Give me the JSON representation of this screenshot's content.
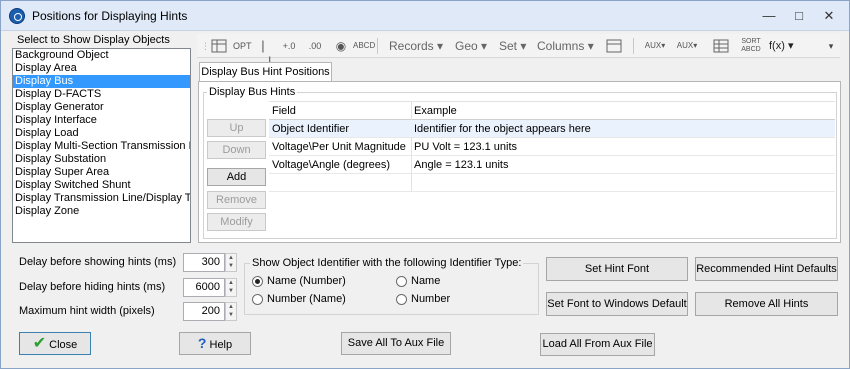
{
  "window": {
    "title": "Positions for Displaying Hints"
  },
  "left_panel": {
    "label": "Select to Show Display Objects",
    "items": [
      "Background Object",
      "Display Area",
      "Display Bus",
      "Display D-FACTS",
      "Display Generator",
      "Display Interface",
      "Display Load",
      "Display Multi-Section Transmission Line",
      "Display Substation",
      "Display Super Area",
      "Display Switched Shunt",
      "Display Transmission Line/Display Transformer",
      "Display Zone"
    ],
    "selected_index": 2
  },
  "toolbar": {
    "records": "Records",
    "geo": "Geo",
    "set": "Set",
    "columns": "Columns",
    "fx": "f(x)",
    "icons": [
      "table-format-icon",
      "optimal-column-width-icon",
      "freeze-panes-icon",
      "decimals-increase-icon",
      "decimals-decrease-icon",
      "find-icon",
      "find-abcd-icon",
      "records-menu",
      "geo-menu",
      "set-menu",
      "columns-menu",
      "auxiliary-export-icon",
      "auxiliary-icon",
      "filter-grid-icon",
      "sort-abcd-icon",
      "function-icon",
      "toolbar-overflow-icon"
    ]
  },
  "tab": {
    "label": "Display Bus Hint Positions"
  },
  "hints_group": {
    "label": "Display Bus Hints",
    "buttons": {
      "up": "Up",
      "down": "Down",
      "add": "Add",
      "remove": "Remove",
      "modify": "Modify"
    },
    "columns": [
      "Field",
      "Example"
    ],
    "rows": [
      {
        "field": "Object Identifier",
        "example": "Identifier for the object appears here"
      },
      {
        "field": "Voltage\\Per Unit Magnitude",
        "example": "PU Volt = 123.1 units"
      },
      {
        "field": "Voltage\\Angle (degrees)",
        "example": "Angle = 123.1 units"
      }
    ]
  },
  "settings": {
    "delay_show_label": "Delay before showing hints (ms)",
    "delay_show_value": "300",
    "delay_hide_label": "Delay before hiding hints (ms)",
    "delay_hide_value": "6000",
    "max_width_label": "Maximum hint width (pixels)",
    "max_width_value": "200"
  },
  "identifier_group": {
    "label": "Show Object Identifier with the following Identifier Type:",
    "options": [
      "Name (Number)",
      "Name",
      "Number (Name)",
      "Number"
    ],
    "selected": "Name (Number)"
  },
  "font_buttons": {
    "set_hint_font": "Set Hint Font",
    "recommended": "Recommended Hint Defaults",
    "set_windows_default": "Set Font to Windows Default",
    "remove_all": "Remove All Hints"
  },
  "bottom": {
    "close": "Close",
    "help": "Help",
    "save_aux": "Save All To Aux File",
    "load_aux": "Load All From Aux File"
  },
  "colors": {
    "selection": "#3399ff",
    "accent_check": "#2e9e2e"
  }
}
